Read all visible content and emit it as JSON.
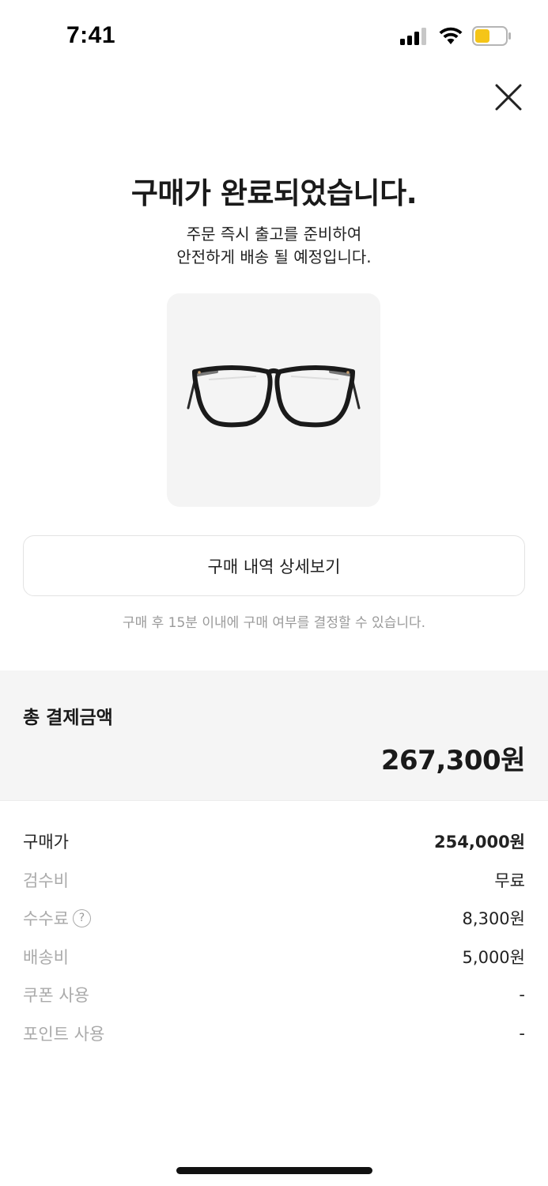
{
  "status_bar": {
    "time": "7:41",
    "battery_color": "#f5c518"
  },
  "header": {
    "close_icon": "close-icon"
  },
  "completion": {
    "title": "구매가 완료되었습니다.",
    "subtitle_line1": "주문 즉시 출고를 준비하여",
    "subtitle_line2": "안전하게 배송 될 예정입니다."
  },
  "product": {
    "image": "eyeglasses-black-frame"
  },
  "actions": {
    "detail_button_label": "구매 내역 상세보기",
    "notice": "구매 후 15분 이내에 구매 여부를 결정할 수 있습니다."
  },
  "total": {
    "label": "총 결제금액",
    "value": "267,300원"
  },
  "breakdown": [
    {
      "label": "구매가",
      "value": "254,000원"
    },
    {
      "label": "검수비",
      "value": "무료"
    },
    {
      "label": "수수료",
      "value": "8,300원",
      "help": "?"
    },
    {
      "label": "배송비",
      "value": "5,000원"
    },
    {
      "label": "쿠폰 사용",
      "value": "-"
    },
    {
      "label": "포인트 사용",
      "value": "-"
    }
  ]
}
